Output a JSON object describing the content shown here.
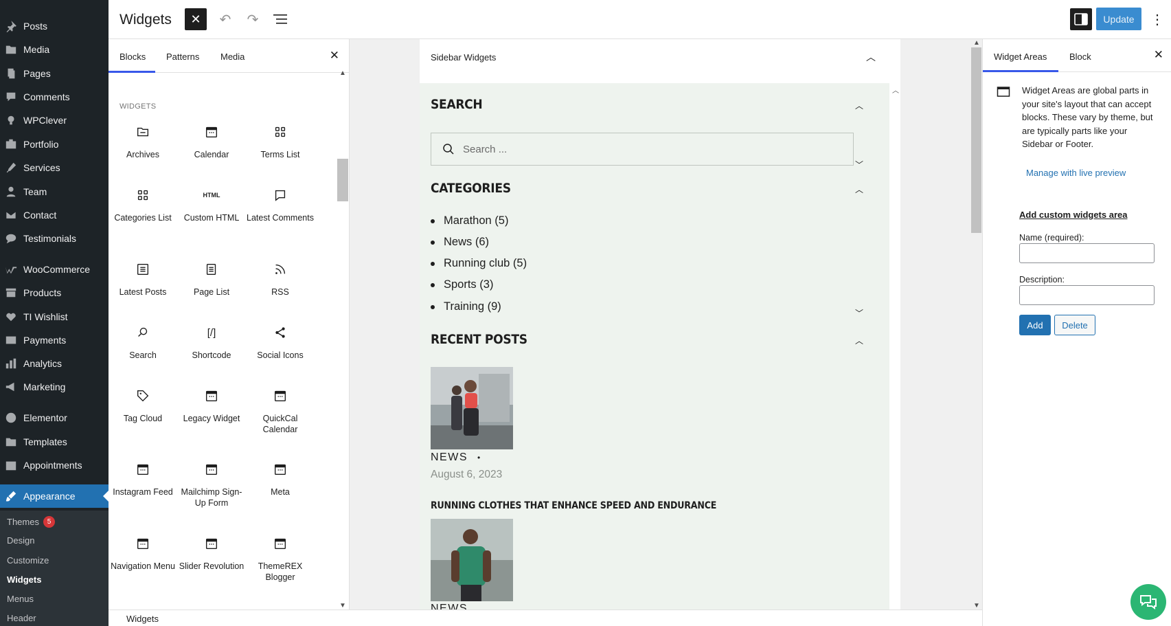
{
  "admin_menu": {
    "items": [
      {
        "label": "Posts",
        "icon": "pushpin-icon"
      },
      {
        "label": "Media",
        "icon": "media-icon"
      },
      {
        "label": "Pages",
        "icon": "pages-icon"
      },
      {
        "label": "Comments",
        "icon": "comments-icon"
      },
      {
        "label": "WPClever",
        "icon": "lightbulb-icon"
      },
      {
        "label": "Portfolio",
        "icon": "portfolio-icon"
      },
      {
        "label": "Services",
        "icon": "tools-icon"
      },
      {
        "label": "Team",
        "icon": "person-icon"
      },
      {
        "label": "Contact",
        "icon": "mail-icon"
      },
      {
        "label": "Testimonials",
        "icon": "chat-bubble-icon"
      },
      {
        "label": "WooCommerce",
        "icon": "woo-icon"
      },
      {
        "label": "Products",
        "icon": "archive-icon"
      },
      {
        "label": "TI Wishlist",
        "icon": "heart-icon"
      },
      {
        "label": "Payments",
        "icon": "dollar-icon"
      },
      {
        "label": "Analytics",
        "icon": "bar-chart-icon"
      },
      {
        "label": "Marketing",
        "icon": "megaphone-icon"
      },
      {
        "label": "Elementor",
        "icon": "elementor-icon"
      },
      {
        "label": "Templates",
        "icon": "folder-icon"
      },
      {
        "label": "Appointments",
        "icon": "calendar-icon"
      },
      {
        "label": "Appearance",
        "icon": "brush-icon"
      }
    ],
    "submenu": [
      {
        "label": "Themes",
        "badge": "5"
      },
      {
        "label": "Design"
      },
      {
        "label": "Customize"
      },
      {
        "label": "Widgets"
      },
      {
        "label": "Menus"
      },
      {
        "label": "Header"
      }
    ]
  },
  "header": {
    "title": "Widgets",
    "update_label": "Update"
  },
  "inserter": {
    "tabs": [
      "Blocks",
      "Patterns",
      "Media"
    ],
    "category_heading": "WIDGETS",
    "blocks": [
      {
        "label": "Archives",
        "icon": "archive-folder-icon"
      },
      {
        "label": "Calendar",
        "icon": "calendar-icon"
      },
      {
        "label": "Terms List",
        "icon": "grid-icon"
      },
      {
        "label": "Categories List",
        "icon": "grid-icon"
      },
      {
        "label": "Custom HTML",
        "icon": "html-icon",
        "icon_text": "HTML"
      },
      {
        "label": "Latest Comments",
        "icon": "comment-icon"
      },
      {
        "label": "Latest Posts",
        "icon": "list-icon"
      },
      {
        "label": "Page List",
        "icon": "page-list-icon"
      },
      {
        "label": "RSS",
        "icon": "rss-icon"
      },
      {
        "label": "Search",
        "icon": "search-icon"
      },
      {
        "label": "Shortcode",
        "icon": "shortcode-icon",
        "icon_text": "[/]"
      },
      {
        "label": "Social Icons",
        "icon": "share-icon"
      },
      {
        "label": "Tag Cloud",
        "icon": "tag-icon"
      },
      {
        "label": "Legacy Widget",
        "icon": "calendar-icon"
      },
      {
        "label": "QuickCal Calendar",
        "icon": "calendar-icon"
      },
      {
        "label": "Instagram Feed",
        "icon": "calendar-icon"
      },
      {
        "label": "Mailchimp Sign-Up Form",
        "icon": "calendar-icon"
      },
      {
        "label": "Meta",
        "icon": "calendar-icon"
      },
      {
        "label": "Navigation Menu",
        "icon": "calendar-icon"
      },
      {
        "label": "Slider Revolution",
        "icon": "calendar-icon"
      },
      {
        "label": "ThemeREX Blogger",
        "icon": "calendar-icon"
      }
    ]
  },
  "canvas": {
    "area_title": "Sidebar Widgets",
    "search": {
      "title": "SEARCH",
      "placeholder": "Search ..."
    },
    "categories": {
      "title": "CATEGORIES",
      "items": [
        "Marathon (5)",
        "News (6)",
        "Running club (5)",
        "Sports (3)",
        "Training (9)"
      ]
    },
    "recent_posts": {
      "title": "RECENT POSTS",
      "posts": [
        {
          "category": "NEWS",
          "date": "August 6, 2023",
          "title": ""
        },
        {
          "category": "NEWS",
          "date": "",
          "title": "RUNNING CLOTHES THAT ENHANCE SPEED AND ENDURANCE"
        }
      ]
    }
  },
  "settings": {
    "tabs": [
      "Widget Areas",
      "Block"
    ],
    "description": "Widget Areas are global parts in your site's layout that can accept blocks. These vary by theme, but are typically parts like your Sidebar or Footer.",
    "live_preview_link": "Manage with live preview",
    "custom_heading": "Add custom widgets area",
    "name_label": "Name (required):",
    "description_label": "Description:",
    "add_label": "Add",
    "delete_label": "Delete"
  },
  "footer": {
    "breadcrumb": "Widgets"
  },
  "colors": {
    "accent": "#3858e9",
    "admin_blue": "#2271b1",
    "admin_bg": "#1d2327",
    "widget_bg": "#eef3ee",
    "chat_green": "#2bb673"
  }
}
